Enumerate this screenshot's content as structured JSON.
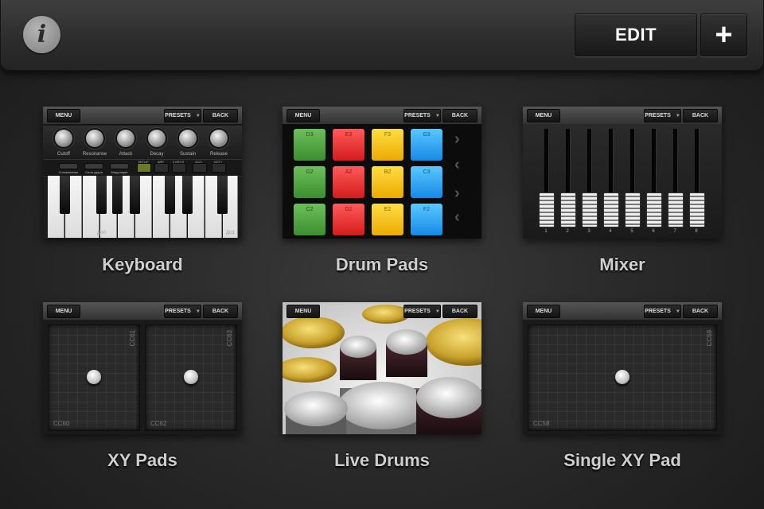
{
  "topbar": {
    "info_icon": "info-icon",
    "edit_label": "EDIT",
    "add_label": "+"
  },
  "tile_bar": {
    "menu": "MENU",
    "presets": "PRESETS",
    "presets_arrow": "▼",
    "back": "BACK"
  },
  "tiles": [
    {
      "label": "Keyboard"
    },
    {
      "label": "Drum Pads"
    },
    {
      "label": "Mixer"
    },
    {
      "label": "XY Pads"
    },
    {
      "label": "Live Drums"
    },
    {
      "label": "Single XY Pad"
    }
  ],
  "keyboard": {
    "knobs": [
      "Cutoff",
      "Resonanse",
      "Attack",
      "Decay",
      "Sustain",
      "Release"
    ],
    "controls": [
      "Сглаживание",
      "Сила удара",
      "Модуляция"
    ],
    "buttons": [
      "SETUP",
      "ARP",
      "2 KEYS",
      "OCT-",
      "OCT+"
    ],
    "note_left": "До0",
    "note_right": "До1"
  },
  "drum_pads": {
    "pads": [
      {
        "note": "D3",
        "color": "green"
      },
      {
        "note": "E3",
        "color": "red"
      },
      {
        "note": "F3",
        "color": "yellow"
      },
      {
        "note": "G3",
        "color": "blue"
      },
      {
        "note": "G2",
        "color": "green"
      },
      {
        "note": "A2",
        "color": "red"
      },
      {
        "note": "B2",
        "color": "yellow"
      },
      {
        "note": "C3",
        "color": "blue"
      },
      {
        "note": "C2",
        "color": "green"
      },
      {
        "note": "D2",
        "color": "red"
      },
      {
        "note": "E2",
        "color": "yellow"
      },
      {
        "note": "F2",
        "color": "blue"
      }
    ]
  },
  "mixer": {
    "channels": [
      "1",
      "2",
      "3",
      "4",
      "5",
      "6",
      "7",
      "8"
    ]
  },
  "xy_pads": {
    "pad1_top": "CC61",
    "pad1_bottom": "CC60",
    "pad2_top": "CC63",
    "pad2_bottom": "CC62"
  },
  "single_xy": {
    "top": "CC59",
    "bottom": "CC58"
  }
}
